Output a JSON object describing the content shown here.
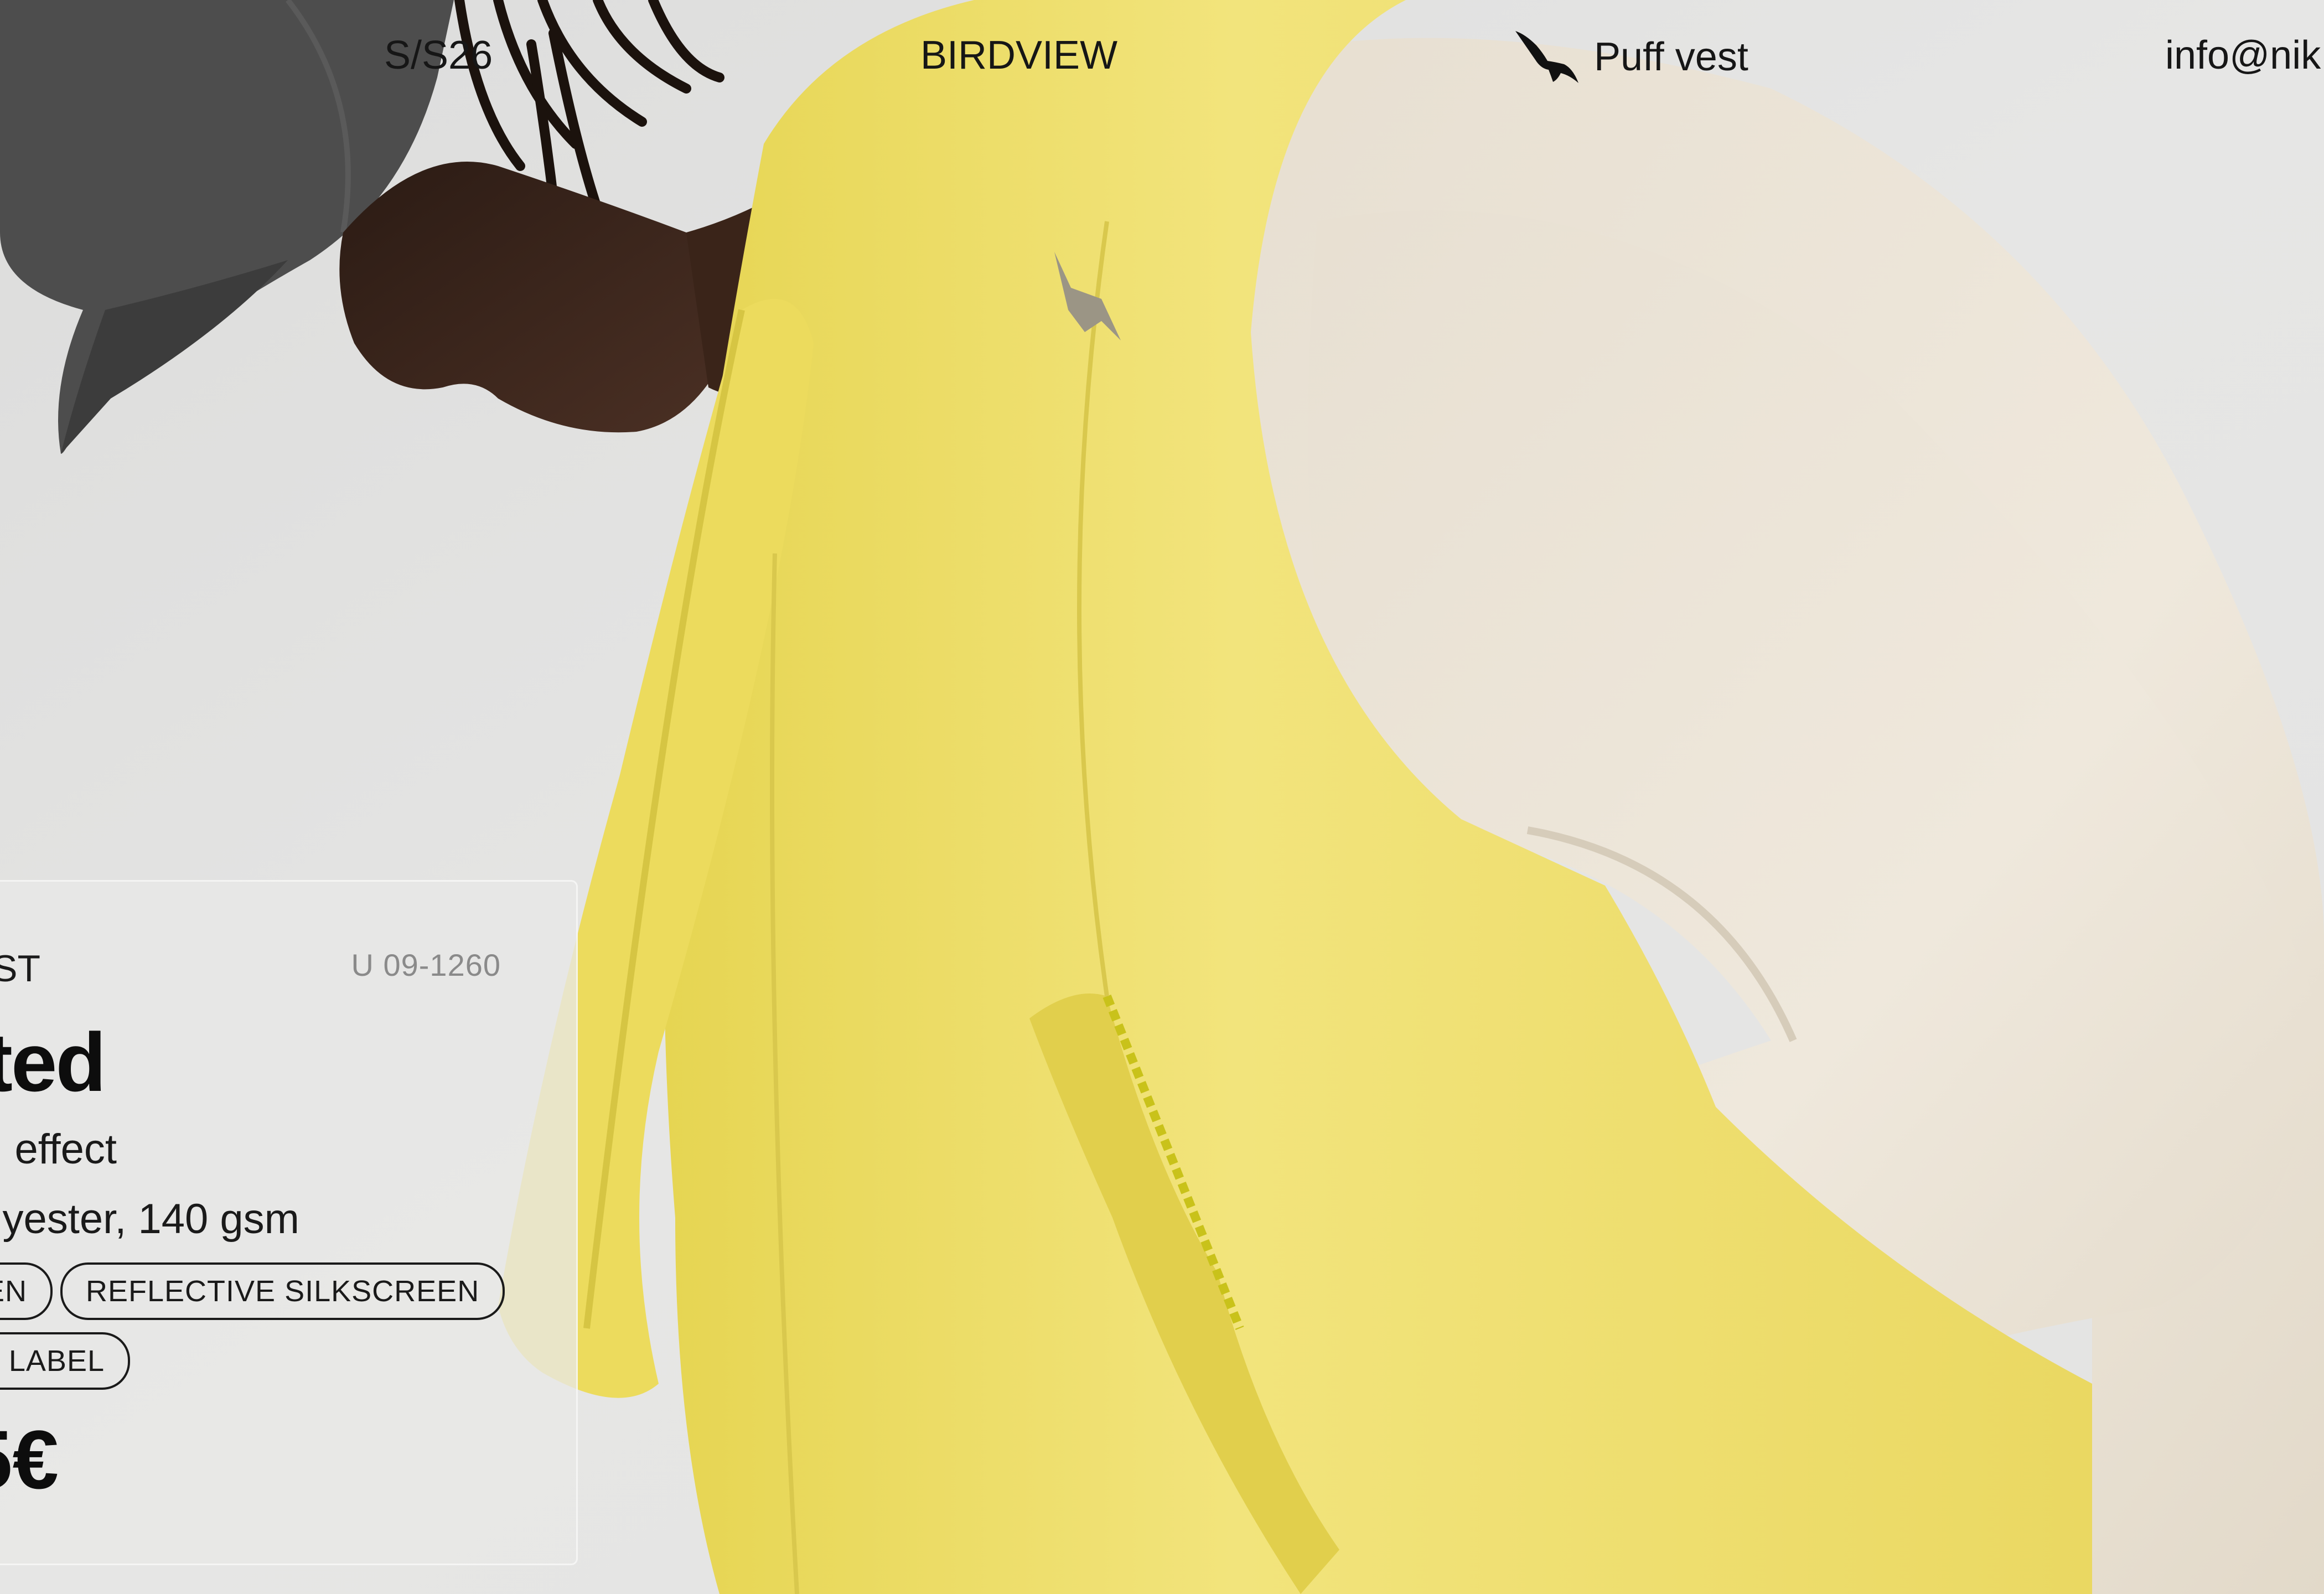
{
  "header": {
    "season": "S/S26",
    "brand": "BIRDVIEW",
    "product_link": "Puff vest",
    "product_link_icon": "bird-icon",
    "email": "info@nik"
  },
  "card": {
    "category": "ST",
    "code": "U 09-1260",
    "name": "ted",
    "description_1": "effect",
    "description_2": "yester, 140 gsm",
    "tags": [
      "EN",
      "REFLECTIVE SILKSCREEN",
      "D LABEL"
    ],
    "price": "5€"
  },
  "colors": {
    "background": "#e6e6e5",
    "vest": "#efe073",
    "sweatshirt": "#ece4d6",
    "cap": "#4a4a4a",
    "text": "#111111"
  }
}
